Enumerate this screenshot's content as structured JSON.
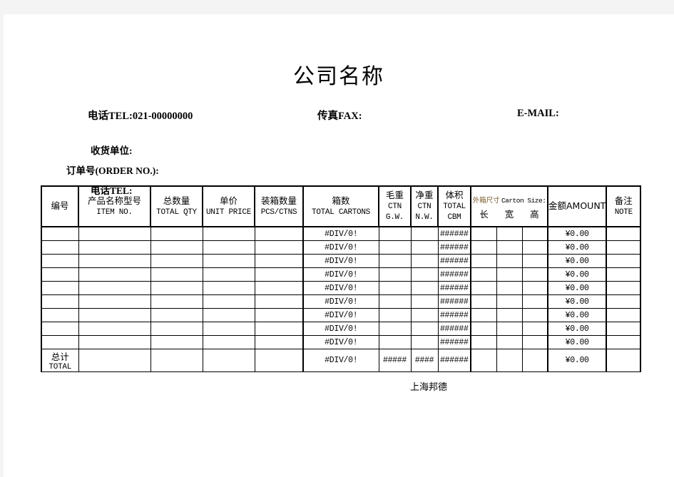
{
  "document": {
    "company_title": "公司名称",
    "footer_note": "上海邦德"
  },
  "contact": {
    "tel": "电话TEL:021-00000000",
    "fax": "传真FAX:",
    "email": "E-MAIL:"
  },
  "form": {
    "consignee_label": "收货单位:",
    "order_no_label": "订单号(ORDER NO.):",
    "tel_label": "电话TEL:"
  },
  "table": {
    "headers": [
      {
        "cn": "编号",
        "en": "",
        "en2": ""
      },
      {
        "cn": "产品名称型号",
        "en": "ITEM NO.",
        "en2": ""
      },
      {
        "cn": "总数量",
        "en": "TOTAL QTY",
        "en2": ""
      },
      {
        "cn": "单价",
        "en": "UNIT PRICE",
        "en2": ""
      },
      {
        "cn": "装箱数量",
        "en": "PCS/CTNS",
        "en2": ""
      },
      {
        "cn": "箱数",
        "en": "TOTAL CARTONS",
        "en2": ""
      },
      {
        "cn": "毛重",
        "en": "CTN",
        "en2": "G.W."
      },
      {
        "cn": "净重",
        "en": "CTN",
        "en2": "N.W."
      },
      {
        "cn": "体积",
        "en": "TOTAL",
        "en2": "CBM"
      },
      {
        "cn": "金额AMOUNT",
        "en": "",
        "en2": ""
      },
      {
        "cn": "备注",
        "en": "NOTE",
        "en2": ""
      }
    ],
    "carton_size": {
      "cn": "外箱尺寸",
      "en": "Carton Size:",
      "sub": [
        "长",
        "宽",
        "高"
      ]
    },
    "rows": [
      {
        "no": "",
        "item": "",
        "qty": "",
        "price": "",
        "pcs": "",
        "cartons": "#DIV/0!",
        "gw": "",
        "nw": "",
        "cbm": "######",
        "len": "",
        "wid": "",
        "hgt": "",
        "amount": "¥0.00",
        "note": ""
      },
      {
        "no": "",
        "item": "",
        "qty": "",
        "price": "",
        "pcs": "",
        "cartons": "#DIV/0!",
        "gw": "",
        "nw": "",
        "cbm": "######",
        "len": "",
        "wid": "",
        "hgt": "",
        "amount": "¥0.00",
        "note": ""
      },
      {
        "no": "",
        "item": "",
        "qty": "",
        "price": "",
        "pcs": "",
        "cartons": "#DIV/0!",
        "gw": "",
        "nw": "",
        "cbm": "######",
        "len": "",
        "wid": "",
        "hgt": "",
        "amount": "¥0.00",
        "note": ""
      },
      {
        "no": "",
        "item": "",
        "qty": "",
        "price": "",
        "pcs": "",
        "cartons": "#DIV/0!",
        "gw": "",
        "nw": "",
        "cbm": "######",
        "len": "",
        "wid": "",
        "hgt": "",
        "amount": "¥0.00",
        "note": ""
      },
      {
        "no": "",
        "item": "",
        "qty": "",
        "price": "",
        "pcs": "",
        "cartons": "#DIV/0!",
        "gw": "",
        "nw": "",
        "cbm": "######",
        "len": "",
        "wid": "",
        "hgt": "",
        "amount": "¥0.00",
        "note": ""
      },
      {
        "no": "",
        "item": "",
        "qty": "",
        "price": "",
        "pcs": "",
        "cartons": "#DIV/0!",
        "gw": "",
        "nw": "",
        "cbm": "######",
        "len": "",
        "wid": "",
        "hgt": "",
        "amount": "¥0.00",
        "note": ""
      },
      {
        "no": "",
        "item": "",
        "qty": "",
        "price": "",
        "pcs": "",
        "cartons": "#DIV/0!",
        "gw": "",
        "nw": "",
        "cbm": "######",
        "len": "",
        "wid": "",
        "hgt": "",
        "amount": "¥0.00",
        "note": ""
      },
      {
        "no": "",
        "item": "",
        "qty": "",
        "price": "",
        "pcs": "",
        "cartons": "#DIV/0!",
        "gw": "",
        "nw": "",
        "cbm": "######",
        "len": "",
        "wid": "",
        "hgt": "",
        "amount": "¥0.00",
        "note": ""
      },
      {
        "no": "",
        "item": "",
        "qty": "",
        "price": "",
        "pcs": "",
        "cartons": "#DIV/0!",
        "gw": "",
        "nw": "",
        "cbm": "######",
        "len": "",
        "wid": "",
        "hgt": "",
        "amount": "¥0.00",
        "note": ""
      }
    ],
    "total": {
      "label_cn": "总计",
      "label_en": "TOTAL",
      "item": "",
      "qty": "",
      "price": "",
      "pcs": "",
      "cartons": "#DIV/0!",
      "gw": "#####",
      "nw": "####",
      "cbm": "######",
      "len": "",
      "wid": "",
      "hgt": "",
      "amount": "¥0.00",
      "note": ""
    }
  },
  "colors": {
    "page_background": "#ffffff",
    "canvas_background": "#f4f4f4",
    "grid_line": "#000000",
    "faint_line": "#999999",
    "carton_size_cn": "#7a5a2a"
  }
}
